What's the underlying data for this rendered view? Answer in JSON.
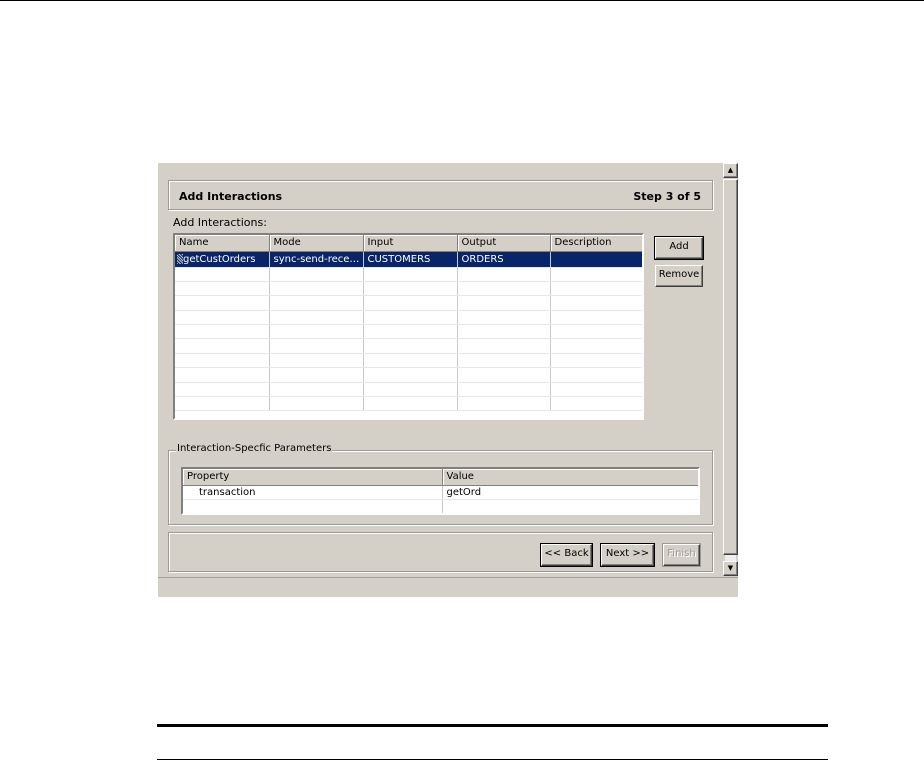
{
  "wizard": {
    "header": {
      "title": "Add Interactions",
      "step": "Step 3 of 5"
    },
    "add_interactions_label": "Add Interactions:",
    "interactions_table": {
      "columns": [
        "Name",
        "Mode",
        "Input",
        "Output",
        "Description"
      ],
      "rows": [
        {
          "name": "getCustOrders",
          "mode": "sync-send-rece…",
          "input": "CUSTOMERS",
          "output": "ORDERS",
          "description": ""
        }
      ]
    },
    "buttons": {
      "add": "Add",
      "remove": "Remove",
      "back": "<< Back",
      "next": "Next >>",
      "finish": "Finish"
    },
    "params": {
      "legend": "Interaction-Specfic Parameters",
      "columns": [
        "Property",
        "Value"
      ],
      "rows": [
        {
          "property": "transaction",
          "value": "getOrd"
        }
      ]
    },
    "scroll": {
      "up_icon": "arrow-up-icon",
      "down_icon": "arrow-down-icon"
    },
    "colors": {
      "face": "#d4d0c8",
      "selection": "#0a246a"
    }
  }
}
